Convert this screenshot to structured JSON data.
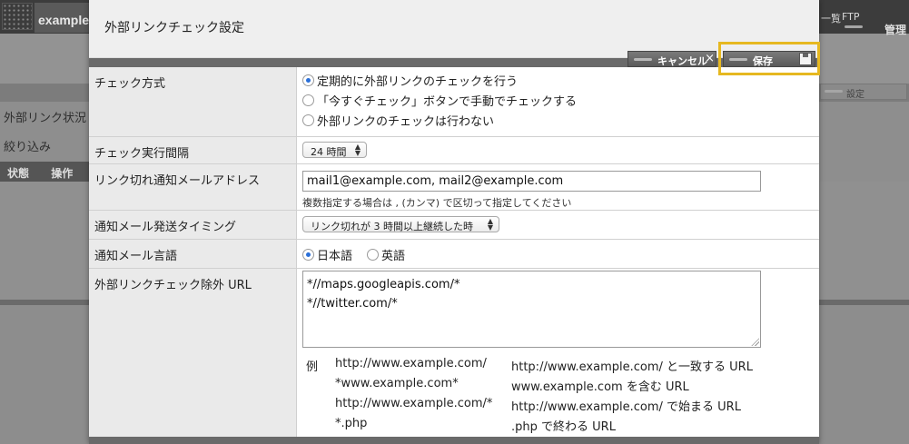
{
  "background": {
    "brand": "example",
    "row_labels": [
      "外部リンク状況",
      "絞り込み"
    ],
    "table_header": [
      "状態",
      "操作"
    ],
    "right_nav": {
      "ftp": "FTP",
      "list_fragment": "一覧",
      "manage": "管理"
    },
    "settings_button": "設定"
  },
  "dialog": {
    "title": "外部リンクチェック設定",
    "cancel_label": "キャンセル",
    "close_glyph": "×",
    "save_label": "保存",
    "rows": {
      "check_method": {
        "label": "チェック方式",
        "options": [
          {
            "label": "定期的に外部リンクのチェックを行う",
            "selected": true
          },
          {
            "label": "「今すぐチェック」ボタンで手動でチェックする",
            "selected": false
          },
          {
            "label": "外部リンクのチェックは行わない",
            "selected": false
          }
        ]
      },
      "interval": {
        "label": "チェック実行間隔",
        "value": "24 時間"
      },
      "email": {
        "label": "リンク切れ通知メールアドレス",
        "value": "mail1@example.com,  mail2@example.com",
        "hint": "複数指定する場合は , (カンマ) で区切って指定してください"
      },
      "timing": {
        "label": "通知メール発送タイミング",
        "value": "リンク切れが 3 時間以上継続した時"
      },
      "language": {
        "label": "通知メール言語",
        "options": [
          {
            "label": "日本語",
            "selected": true
          },
          {
            "label": "英語",
            "selected": false
          }
        ]
      },
      "exclude": {
        "label": "外部リンクチェック除外 URL",
        "lines": [
          "*//maps.googleapis.com/*",
          "*//twitter.com/*"
        ],
        "example_marker": "例",
        "examples": [
          {
            "pattern": "http://www.example.com/",
            "meaning": "http://www.example.com/ と一致する URL"
          },
          {
            "pattern": "*www.example.com*",
            "meaning": "www.example.com を含む URL"
          },
          {
            "pattern": "http://www.example.com/*",
            "meaning": "http://www.example.com/ で始まる URL"
          },
          {
            "pattern": "*.php",
            "meaning": ".php で終わる URL"
          }
        ]
      }
    }
  }
}
